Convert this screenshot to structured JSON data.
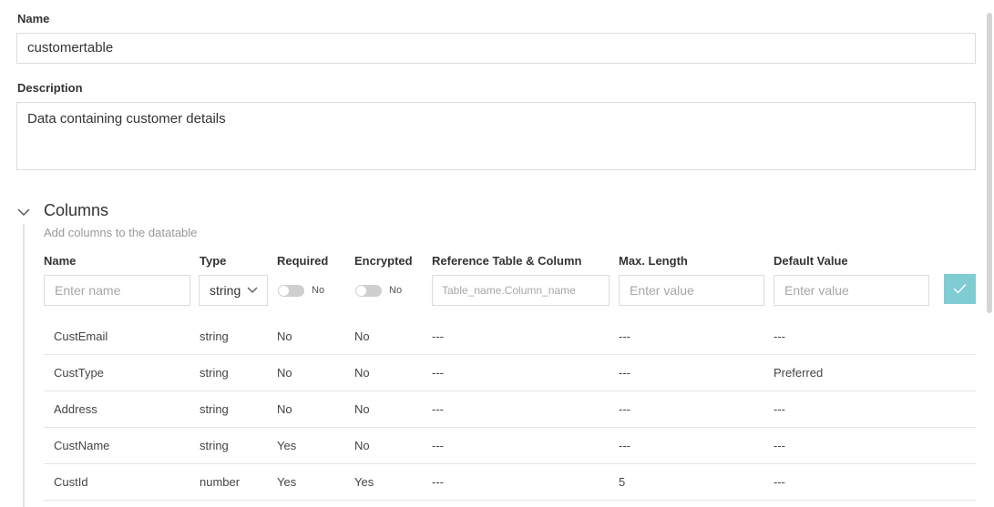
{
  "form": {
    "name_label": "Name",
    "name_value": "customertable",
    "description_label": "Description",
    "description_value": "Data containing customer details"
  },
  "columns_section": {
    "title": "Columns",
    "subtitle": "Add columns to the datatable",
    "headers": {
      "name": "Name",
      "type": "Type",
      "required": "Required",
      "encrypted": "Encrypted",
      "reference": "Reference Table & Column",
      "max_length": "Max. Length",
      "default_value": "Default Value"
    },
    "new_column": {
      "name_placeholder": "Enter name",
      "type_value": "string",
      "required_value": "No",
      "encrypted_value": "No",
      "reference_placeholder": "Table_name.Column_name",
      "max_length_placeholder": "Enter value",
      "default_value_placeholder": "Enter value"
    },
    "rows": [
      {
        "name": "CustEmail",
        "type": "string",
        "required": "No",
        "encrypted": "No",
        "reference": "---",
        "max_length": "---",
        "default_value": "---"
      },
      {
        "name": "CustType",
        "type": "string",
        "required": "No",
        "encrypted": "No",
        "reference": "---",
        "max_length": "---",
        "default_value": "Preferred"
      },
      {
        "name": "Address",
        "type": "string",
        "required": "No",
        "encrypted": "No",
        "reference": "---",
        "max_length": "---",
        "default_value": "---"
      },
      {
        "name": "CustName",
        "type": "string",
        "required": "Yes",
        "encrypted": "No",
        "reference": "---",
        "max_length": "---",
        "default_value": "---"
      },
      {
        "name": "CustId",
        "type": "number",
        "required": "Yes",
        "encrypted": "Yes",
        "reference": "---",
        "max_length": "5",
        "default_value": "---"
      }
    ]
  },
  "colors": {
    "accent": "#7fcdd3",
    "border": "#dcdcdc",
    "muted_text": "#999999"
  },
  "icons": {
    "section_toggle": "chevron-down-icon",
    "type_dropdown": "chevron-down-icon",
    "confirm": "check-icon"
  }
}
